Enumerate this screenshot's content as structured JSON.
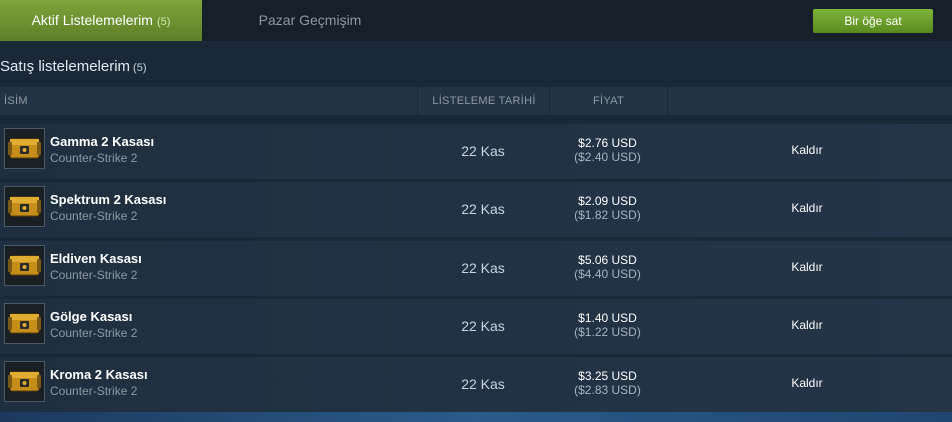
{
  "tabs": {
    "active_label": "Aktif Listelemelerim",
    "active_count": "(5)",
    "inactive_label": "Pazar Geçmişim"
  },
  "sell_button_label": "Bir öğe sat",
  "section": {
    "title": "Satış listelemelerim",
    "count": "(5)"
  },
  "columns": {
    "name": "İSİM",
    "date": "LİSTELEME TARİHİ",
    "price": "FİYAT"
  },
  "listings": [
    {
      "name": "Gamma 2 Kasası",
      "game": "Counter-Strike 2",
      "date": "22 Kas",
      "price": "$2.76 USD",
      "price_net": "($2.40 USD)",
      "action": "Kaldır",
      "icon": "weapon-case-icon"
    },
    {
      "name": "Spektrum 2 Kasası",
      "game": "Counter-Strike 2",
      "date": "22 Kas",
      "price": "$2.09 USD",
      "price_net": "($1.82 USD)",
      "action": "Kaldır",
      "icon": "weapon-case-icon"
    },
    {
      "name": "Eldiven Kasası",
      "game": "Counter-Strike 2",
      "date": "22 Kas",
      "price": "$5.06 USD",
      "price_net": "($4.40 USD)",
      "action": "Kaldır",
      "icon": "weapon-case-icon"
    },
    {
      "name": "Gölge Kasası",
      "game": "Counter-Strike 2",
      "date": "22 Kas",
      "price": "$1.40 USD",
      "price_net": "($1.22 USD)",
      "action": "Kaldır",
      "icon": "weapon-case-icon"
    },
    {
      "name": "Kroma 2 Kasası",
      "game": "Counter-Strike 2",
      "date": "22 Kas",
      "price": "$3.25 USD",
      "price_net": "($2.83 USD)",
      "action": "Kaldır",
      "icon": "weapon-case-icon"
    }
  ],
  "colors": {
    "background": "#1b2838",
    "active_tab": "#6b8a2b",
    "sell_button": "#6ea42e",
    "row": "#213346"
  }
}
